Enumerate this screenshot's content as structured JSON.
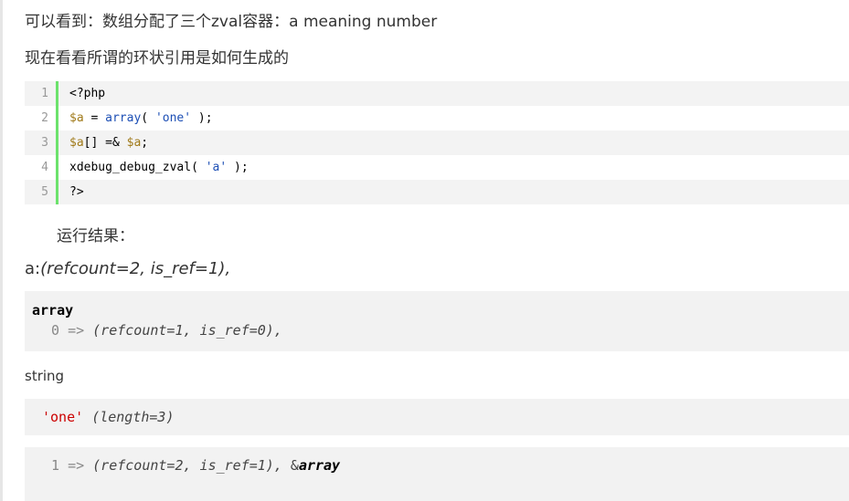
{
  "intro_line": "可以看到：数组分配了三个zval容器：a   meaning   number",
  "sub_line": "现在看看所谓的环状引用是如何生成的",
  "code": {
    "line_numbers": [
      "1",
      "2",
      "3",
      "4",
      "5"
    ],
    "line1": "<?php",
    "line2": {
      "var": "$a",
      "eq": " = ",
      "fn": "array",
      "open": "( ",
      "str": "'one'",
      "close": " );"
    },
    "line3": {
      "var1": "$a",
      "mid": "[] =& ",
      "var2": "$a",
      "end": ";"
    },
    "line4": {
      "fn": "xdebug_debug_zval",
      "open": "( ",
      "str": "'a'",
      "close": " );"
    },
    "line5": "?>"
  },
  "result_label": "运行结果：",
  "a_line": {
    "prefix": "a:",
    "rest": "(refcount=2, is_ref=1),"
  },
  "box1": {
    "keyword": "array",
    "key": "0",
    "arrow": "=>",
    "info": "(refcount=1, is_ref=0),"
  },
  "string_label": "string",
  "box2": {
    "value": "'one'",
    "info": "(length=3)"
  },
  "box3": {
    "key": "1",
    "arrow": "=>",
    "info": "(refcount=2, is_ref=1),",
    "amp": "&",
    "keyword": "array"
  }
}
